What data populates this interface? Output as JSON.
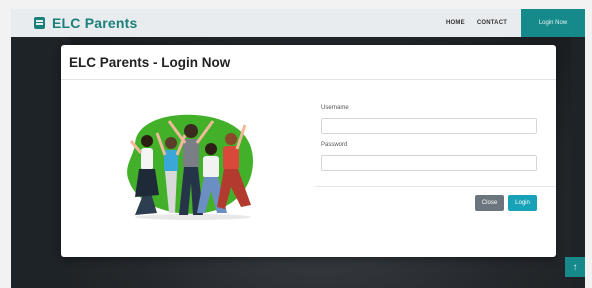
{
  "navbar": {
    "brand": "ELC Parents",
    "links": [
      "HOME",
      "CONTACT"
    ],
    "cta": "Login Now"
  },
  "modal": {
    "title": "ELC Parents - Login Now",
    "username_label": "Username",
    "password_label": "Password",
    "username_value": "",
    "password_value": "",
    "close_label": "Close",
    "login_label": "Login"
  },
  "scroll_top": {
    "glyph": "↑"
  },
  "colors": {
    "brand": "#1b7f7a",
    "cta_bg": "#168a8a",
    "close_button": "#6c757d",
    "login_button": "#17a2b8",
    "blob": "#43b02a"
  },
  "icons": [
    "brand-book-icon",
    "arrow-up-icon"
  ]
}
